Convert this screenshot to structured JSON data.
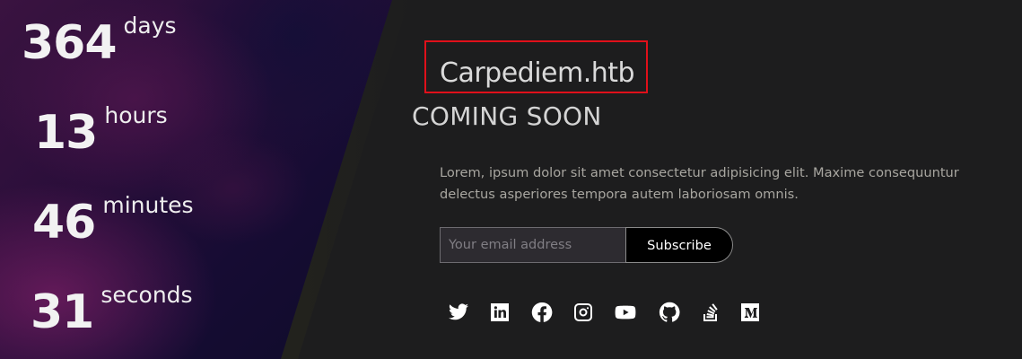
{
  "countdown": {
    "days": {
      "value": "364",
      "unit": "days"
    },
    "hours": {
      "value": "13",
      "unit": "hours"
    },
    "minutes": {
      "value": "46",
      "unit": "minutes"
    },
    "seconds": {
      "value": "31",
      "unit": "seconds"
    }
  },
  "brand": {
    "title": "Carpediem.htb"
  },
  "headline": "COMING SOON",
  "description": "Lorem, ipsum dolor sit amet consectetur adipisicing elit. Maxime consequuntur delectus asperiores tempora autem laboriosam omnis.",
  "subscribe": {
    "placeholder": "Your email address",
    "value": "",
    "button_label": "Subscribe"
  },
  "social_links": [
    "twitter-icon",
    "linkedin-icon",
    "facebook-icon",
    "instagram-icon",
    "youtube-icon",
    "github-icon",
    "stackoverflow-icon",
    "medium-icon"
  ],
  "colors": {
    "background": "#1d1d1e",
    "highlight_box": "#e0101a",
    "text_muted": "#a8a6a0",
    "button_bg": "#000000"
  }
}
